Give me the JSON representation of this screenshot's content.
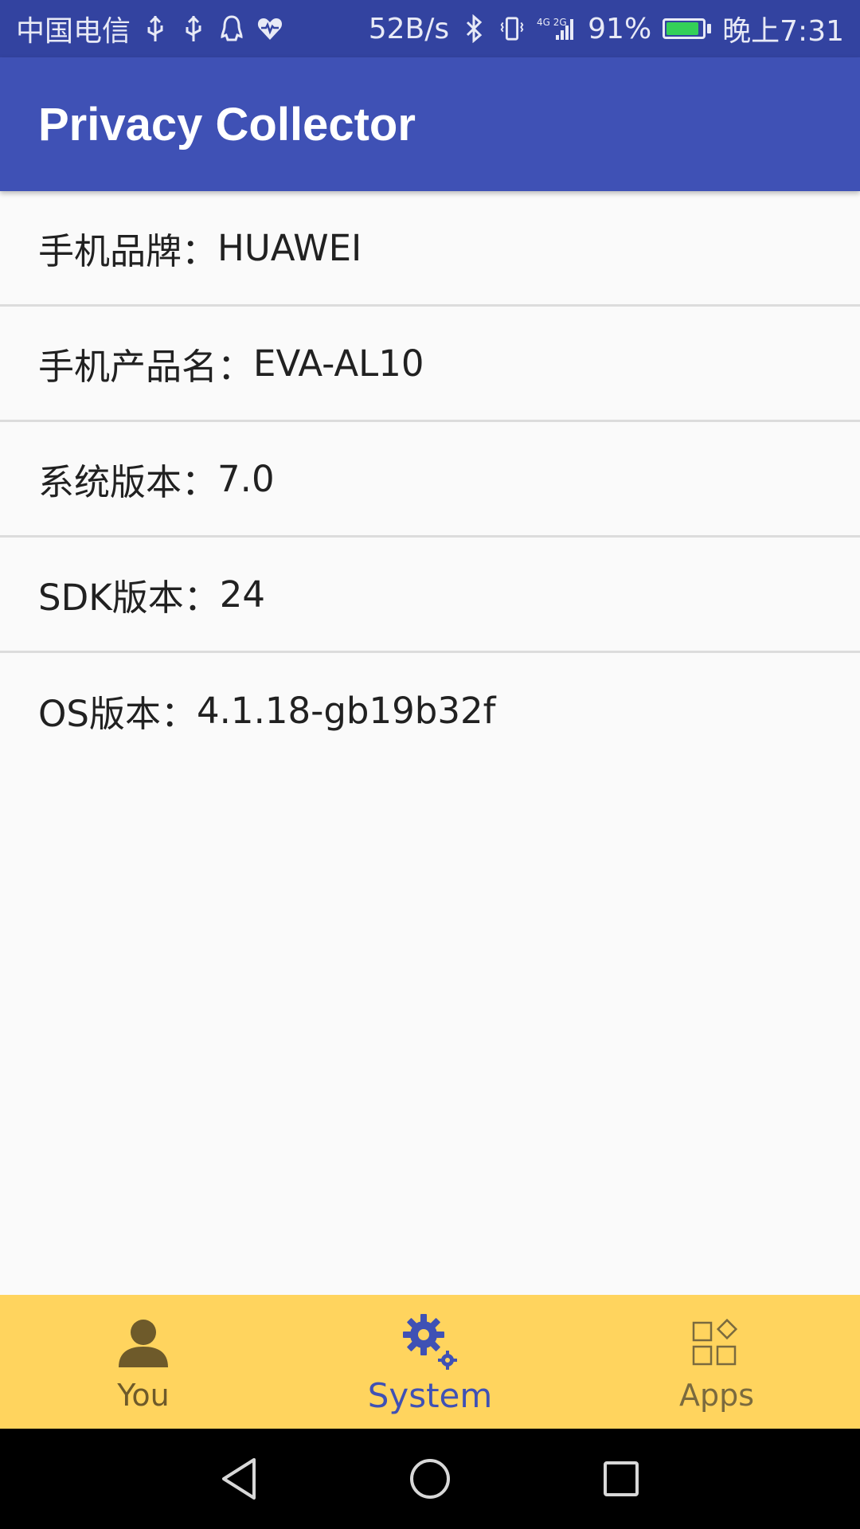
{
  "status_bar": {
    "carrier": "中国电信",
    "speed": "52B/s",
    "network_badge": "4G 2G",
    "battery_percent": "91%",
    "battery_level": 0.91,
    "time": "晚上7:31",
    "icons": [
      "usb-icon",
      "usb-icon",
      "qq-icon",
      "health-icon",
      "bluetooth-icon",
      "vibrate-icon",
      "signal-icon",
      "battery-icon"
    ]
  },
  "app_bar": {
    "title": "Privacy Collector"
  },
  "info": {
    "rows": [
      {
        "label": "手机品牌：",
        "value": "HUAWEI"
      },
      {
        "label": "手机产品名：",
        "value": "EVA-AL10"
      },
      {
        "label": "系统版本：",
        "value": "7.0"
      },
      {
        "label": "SDK版本：",
        "value": "24"
      },
      {
        "label": "OS版本：",
        "value": "4.1.18-gb19b32f"
      }
    ]
  },
  "bottom_nav": {
    "items": [
      {
        "label": "You",
        "icon": "person-icon",
        "selected": false
      },
      {
        "label": "System",
        "icon": "gear-icon",
        "selected": true
      },
      {
        "label": "Apps",
        "icon": "apps-grid-icon",
        "selected": false
      }
    ]
  },
  "colors": {
    "status_bar": "#3343a0",
    "app_bar": "#3f51b5",
    "bottom_nav": "#ffd45e",
    "accent": "#3f51b5"
  }
}
